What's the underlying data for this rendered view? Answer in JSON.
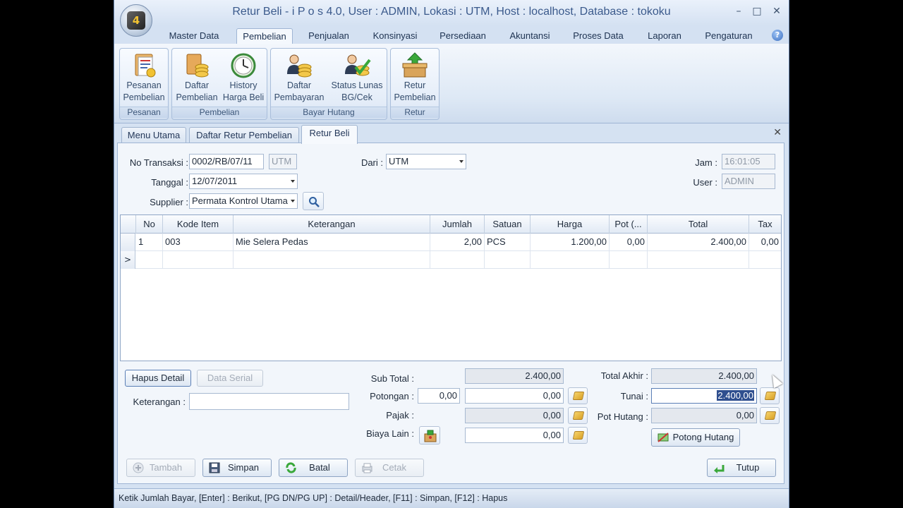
{
  "window": {
    "title": "Retur Beli - i P o s 4.0,  User : ADMIN, Lokasi : UTM, Host : localhost, Database : tokoku",
    "app_icon_text": "4",
    "minimize": "–",
    "maximize": "□",
    "close": "✕"
  },
  "ribbon_tabs": [
    "Master Data",
    "Pembelian",
    "Penjualan",
    "Konsinyasi",
    "Persediaan",
    "Akuntansi",
    "Proses Data",
    "Laporan",
    "Pengaturan"
  ],
  "ribbon_active_tab": "Pembelian",
  "help_icon": "?",
  "ribbon_groups": {
    "pesanan": {
      "label": "Pesanan",
      "buttons": [
        {
          "line1": "Pesanan",
          "line2": "Pembelian",
          "icon": "purchase-order-icon"
        }
      ]
    },
    "pembelian": {
      "label": "Pembelian",
      "buttons": [
        {
          "line1": "Daftar",
          "line2": "Pembelian",
          "icon": "purchase-list-icon"
        },
        {
          "line1": "History",
          "line2": "Harga Beli",
          "icon": "clock-icon"
        }
      ]
    },
    "bayar_hutang": {
      "label": "Bayar Hutang",
      "buttons": [
        {
          "line1": "Daftar",
          "line2": "Pembayaran",
          "icon": "payment-list-icon"
        },
        {
          "line1": "Status Lunas",
          "line2": "BG/Cek",
          "icon": "check-status-icon"
        }
      ]
    },
    "retur": {
      "label": "Retur",
      "buttons": [
        {
          "line1": "Retur",
          "line2": "Pembelian",
          "icon": "return-box-icon"
        }
      ]
    }
  },
  "doc_tabs": [
    "Menu Utama",
    "Daftar Retur Pembelian",
    "Retur Beli"
  ],
  "doc_active_tab": "Retur Beli",
  "doc_close": "✕",
  "form": {
    "no_transaksi_label": "No Transaksi :",
    "no_transaksi_value": "0002/RB/07/11",
    "no_transaksi_suffix": "UTM",
    "tanggal_label": "Tanggal :",
    "tanggal_value": "12/07/2011",
    "supplier_label": "Supplier :",
    "supplier_value": "Permata Kontrol Utama",
    "dari_label": "Dari :",
    "dari_value": "UTM",
    "jam_label": "Jam :",
    "jam_value": "16:01:05",
    "user_label": "User :",
    "user_value": "ADMIN"
  },
  "grid": {
    "columns": [
      "No",
      "Kode Item",
      "Keterangan",
      "Jumlah",
      "Satuan",
      "Harga",
      "Pot (...",
      "Total",
      "Tax"
    ],
    "rows": [
      {
        "no": "1",
        "kode": "003",
        "keterangan": "Mie Selera Pedas",
        "jumlah": "2,00",
        "satuan": "PCS",
        "harga": "1.200,00",
        "pot": "0,00",
        "total": "2.400,00",
        "tax": "0,00"
      }
    ],
    "new_row_marker": ">"
  },
  "detail_buttons": {
    "hapus_detail": "Hapus Detail",
    "data_serial": "Data Serial"
  },
  "keterangan_label": "Keterangan :",
  "keterangan_value": "",
  "totals": {
    "sub_total_label": "Sub Total :",
    "sub_total_value": "2.400,00",
    "potongan_label": "Potongan :",
    "potongan_pct": "0,00",
    "potongan_value": "0,00",
    "pajak_label": "Pajak :",
    "pajak_value": "0,00",
    "biaya_lain_label": "Biaya Lain :",
    "biaya_lain_value": "0,00",
    "total_akhir_label": "Total Akhir :",
    "total_akhir_value": "2.400,00",
    "tunai_label": "Tunai :",
    "tunai_value": "2.400,00",
    "pot_hutang_label": "Pot Hutang :",
    "pot_hutang_value": "0,00",
    "potong_hutang_button": "Potong Hutang"
  },
  "bottom_buttons": {
    "tambah": "Tambah",
    "simpan": "Simpan",
    "batal": "Batal",
    "cetak": "Cetak",
    "tutup": "Tutup"
  },
  "status_bar": "Ketik Jumlah Bayar, [Enter] : Berikut, [PG DN/PG UP] : Detail/Header, [F11] : Simpan, [F12] : Hapus"
}
